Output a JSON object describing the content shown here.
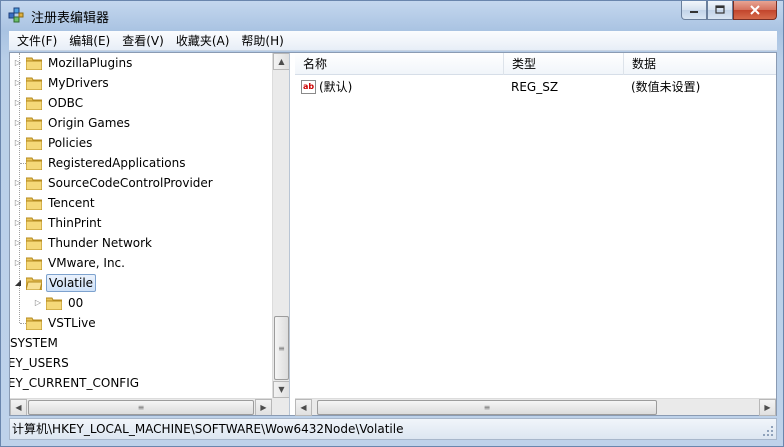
{
  "window": {
    "title": "注册表编辑器",
    "minimize_label": "",
    "maximize_label": "",
    "close_label": ""
  },
  "menu": [
    "文件(F)",
    "编辑(E)",
    "查看(V)",
    "收藏夹(A)",
    "帮助(H)"
  ],
  "tree": {
    "items": [
      {
        "label": "MozillaPlugins",
        "expandable": true
      },
      {
        "label": "MyDrivers",
        "expandable": true
      },
      {
        "label": "ODBC",
        "expandable": true
      },
      {
        "label": "Origin Games",
        "expandable": true
      },
      {
        "label": "Policies",
        "expandable": true
      },
      {
        "label": "RegisteredApplications",
        "expandable": false
      },
      {
        "label": "SourceCodeControlProvider",
        "expandable": true
      },
      {
        "label": "Tencent",
        "expandable": true
      },
      {
        "label": "ThinPrint",
        "expandable": true
      },
      {
        "label": "Thunder Network",
        "expandable": true
      },
      {
        "label": "VMware, Inc.",
        "expandable": true
      },
      {
        "label": "Volatile",
        "expandable": true,
        "expanded": true,
        "selected": true
      },
      {
        "label": "00",
        "expandable": true,
        "child": true
      },
      {
        "label": "VSTLive",
        "expandable": false
      }
    ],
    "roots": [
      "SYSTEM",
      "KEY_USERS",
      "KEY_CURRENT_CONFIG"
    ]
  },
  "list": {
    "columns": [
      "名称",
      "类型",
      "数据"
    ],
    "rows": [
      {
        "name": "(默认)",
        "type": "REG_SZ",
        "data": "(数值未设置)"
      }
    ]
  },
  "status": {
    "path": "计算机\\HKEY_LOCAL_MACHINE\\SOFTWARE\\Wow6432Node\\Volatile"
  },
  "colors": {
    "folder": "#e8c35a",
    "selection_border": "#7da2ce"
  }
}
